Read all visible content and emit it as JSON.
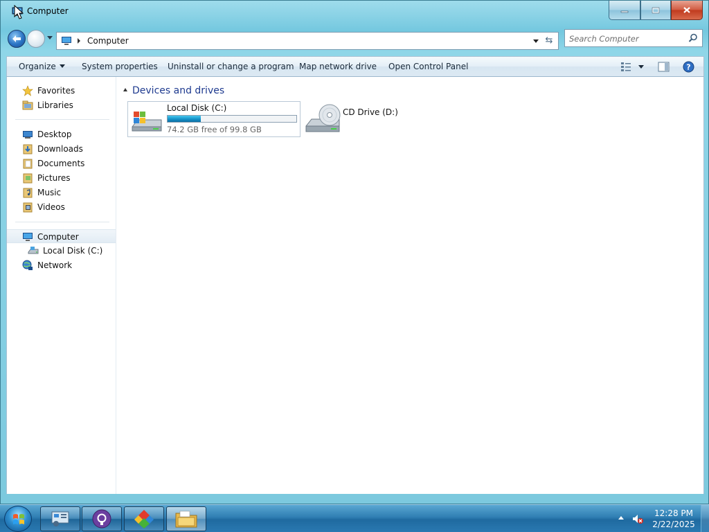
{
  "window": {
    "title": "Computer"
  },
  "address": {
    "crumb": "Computer"
  },
  "search": {
    "placeholder": "Search Computer"
  },
  "toolbar": {
    "organize": "Organize",
    "system_properties": "System properties",
    "uninstall": "Uninstall or change a program",
    "map_drive": "Map network drive",
    "control_panel": "Open Control Panel"
  },
  "sidebar": {
    "favorites": [
      {
        "label": "Favorites",
        "icon": "star-icon"
      },
      {
        "label": "Libraries",
        "icon": "libraries-icon"
      }
    ],
    "places": [
      {
        "label": "Desktop",
        "icon": "desktop-icon"
      },
      {
        "label": "Downloads",
        "icon": "downloads-icon"
      },
      {
        "label": "Documents",
        "icon": "documents-icon"
      },
      {
        "label": "Pictures",
        "icon": "pictures-icon"
      },
      {
        "label": "Music",
        "icon": "music-icon"
      },
      {
        "label": "Videos",
        "icon": "videos-icon"
      }
    ],
    "computer": {
      "label": "Computer",
      "icon": "computer-icon"
    },
    "local_disk": {
      "label": "Local Disk (C:)",
      "icon": "hard-drive-icon"
    },
    "network": {
      "label": "Network",
      "icon": "network-icon"
    }
  },
  "main": {
    "group_header": "Devices and drives",
    "drives": [
      {
        "name": "Local Disk (C:)",
        "free_text": "74.2 GB free of 99.8 GB",
        "used_fraction": 0.257,
        "icon": "hard-drive-icon"
      },
      {
        "name": "CD Drive (D:)",
        "icon": "cd-drive-icon"
      }
    ]
  },
  "taskbar": {
    "buttons": [
      {
        "icon": "control-panel-icon"
      },
      {
        "icon": "github-icon"
      },
      {
        "icon": "app-diamond-icon"
      },
      {
        "icon": "explorer-folder-icon",
        "active": true
      }
    ],
    "clock": {
      "time": "12:28 PM",
      "date": "2/22/2025"
    }
  },
  "colors": {
    "progress_fill": "#1592c8",
    "link_header": "#1e3a8f",
    "taskbar": "#1f6aa0"
  }
}
